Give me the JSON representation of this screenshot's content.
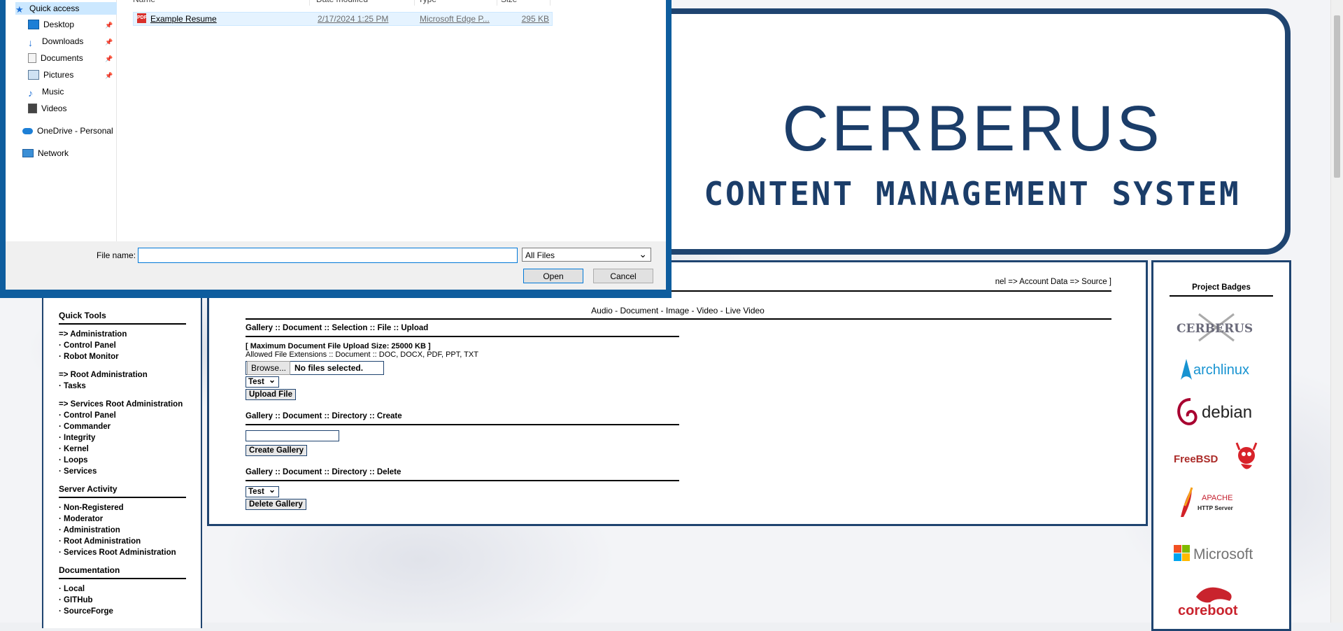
{
  "banner": {
    "title": "CERBERUS",
    "subtitle": "CONTENT MANAGEMENT SYSTEM"
  },
  "left_sidebar": {
    "quick_tools_title": "Quick Tools",
    "administration_link": "=> Administration",
    "admin_items": [
      "· Control Panel",
      "· Robot Monitor"
    ],
    "root_admin_link": "=> Root Administration",
    "root_items": [
      "· Tasks"
    ],
    "services_root_link": "=> Services Root Administration",
    "services_items": [
      "· Control Panel",
      "· Commander",
      "· Integrity",
      "· Kernel",
      "· Loops",
      "· Services"
    ],
    "server_activity_title": "Server Activity",
    "server_items": [
      "· Non-Registered",
      "· Moderator",
      "· Administration",
      "· Root Administration",
      "· Services Root Administration"
    ],
    "documentation_title": "Documentation",
    "doc_items": [
      "· Local",
      "· GITHub",
      "· SourceForge"
    ]
  },
  "main": {
    "breadcrumb_tail": "nel => Account Data => Source ]",
    "media_nav": "Audio - Document - Image - Video - Live Video",
    "upload_title": "Gallery :: Document :: Selection :: File :: Upload",
    "max_size": "[ Maximum Document File Upload Size: 25000 KB ]",
    "allowed_ext": "Allowed File Extensions :: Document :: DOC, DOCX, PDF, PPT, TXT",
    "browse_label": "Browse...",
    "no_file_label": "No files selected.",
    "upload_select_value": "Test",
    "upload_button": "Upload File",
    "create_title": "Gallery :: Document :: Directory :: Create",
    "create_button": "Create Gallery",
    "delete_title": "Gallery :: Document :: Directory :: Delete",
    "delete_select_value": "Test",
    "delete_button": "Delete Gallery"
  },
  "right_sidebar": {
    "title": "Project Badges",
    "badges": [
      "CERBERUS",
      "archlinux",
      "debian",
      "FreeBSD",
      "APACHE",
      "HTTP Server",
      "Microsoft",
      "coreboot"
    ]
  },
  "dialog": {
    "nav": {
      "quick_access": "Quick access",
      "desktop": "Desktop",
      "downloads": "Downloads",
      "documents": "Documents",
      "pictures": "Pictures",
      "music": "Music",
      "videos": "Videos",
      "onedrive": "OneDrive - Personal",
      "network": "Network"
    },
    "columns": [
      "Name",
      "Date modified",
      "Type",
      "Size"
    ],
    "file": {
      "name": "Example Resume",
      "date": "2/17/2024 1:25 PM",
      "type": "Microsoft Edge P...",
      "size": "295 KB"
    },
    "file_name_label": "File name:",
    "file_name_value": "",
    "file_type": "All Files",
    "open_button": "Open",
    "cancel_button": "Cancel"
  },
  "colors": {
    "frame_blue": "#1f4470",
    "dialog_blue": "#0e5d9e"
  }
}
